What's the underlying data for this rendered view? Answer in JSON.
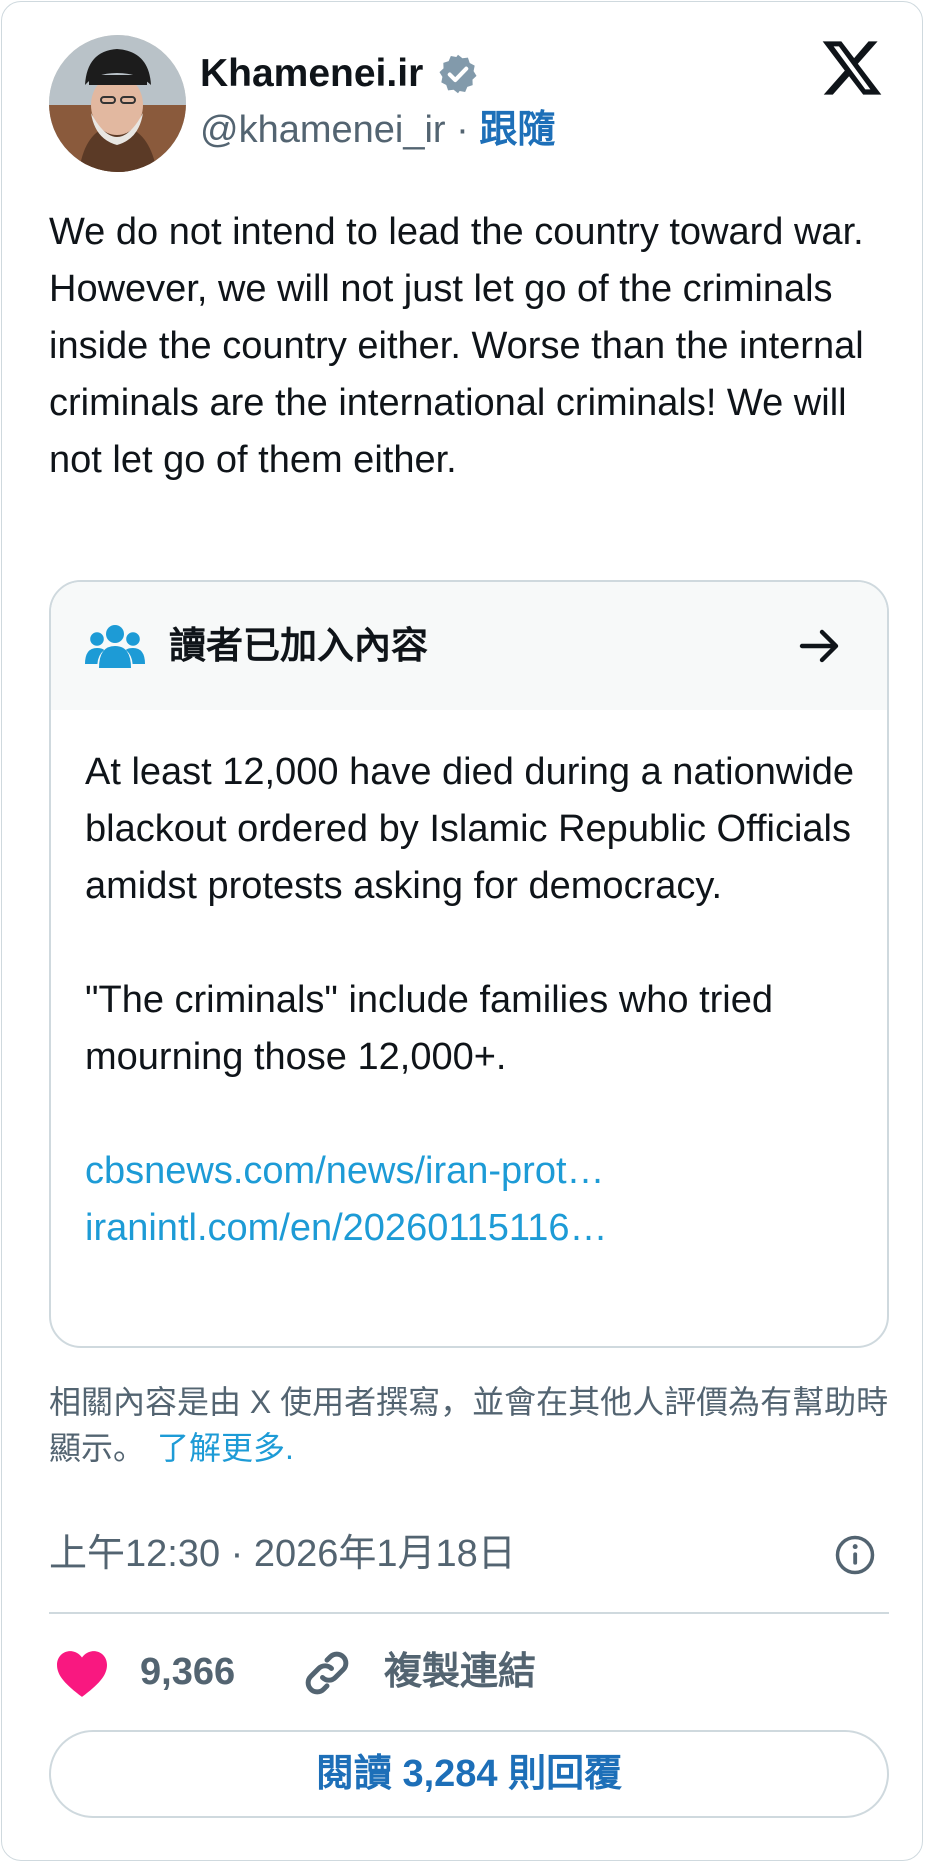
{
  "author": {
    "display_name": "Khamenei.ir",
    "handle": "@khamenei_ir",
    "separator": "·",
    "follow_label": "跟隨",
    "verified": true
  },
  "tweet": {
    "text": "We do not intend to lead the country toward war. However, we will not just let go of the criminals inside the country either. Worse than the internal criminals are the international criminals! We will not let go of them either."
  },
  "community_note": {
    "title": "讀者已加入內容",
    "paragraph_1": "At least 12,000 have died during a nationwide blackout ordered by Islamic Republic Officials amidst protests asking for democracy.",
    "paragraph_2": "\"The criminals\" include families who tried mourning those 12,000+.",
    "links": [
      "cbsnews.com/news/iran-prot…",
      "iranintl.com/en/20260115116…"
    ]
  },
  "disclaimer": {
    "text": "相關內容是由 X 使用者撰寫，並會在其他人評價為有幫助時顯示。",
    "learn_more": "了解更多."
  },
  "timestamp": "上午12:30 · 2026年1月18日",
  "actions": {
    "like_count": "9,366",
    "copy_link_label": "複製連結",
    "read_replies_label": "閱讀 3,284 則回覆"
  },
  "colors": {
    "link_blue": "#1d9bd6",
    "follow_blue": "#1d6fb8",
    "heart": "#f91880",
    "secondary_text": "#536471",
    "border": "#cfd9de"
  },
  "icons": {
    "verified": "verified-badge-icon",
    "logo": "x-logo-icon",
    "note": "people-icon",
    "arrow": "arrow-right-icon",
    "info": "info-icon",
    "like": "heart-icon",
    "copy": "link-icon"
  }
}
